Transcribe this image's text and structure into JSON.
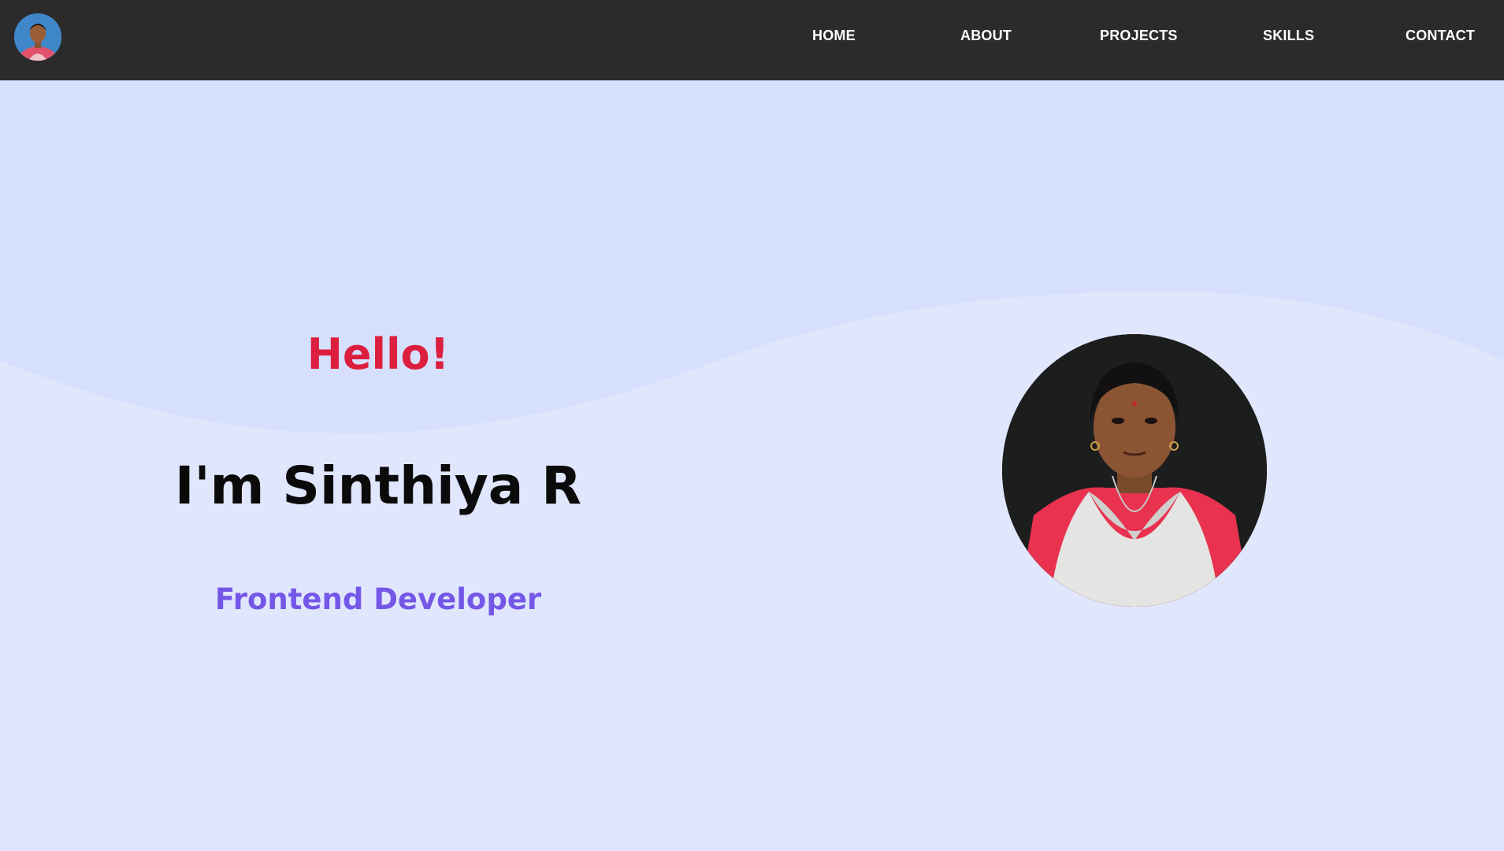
{
  "nav": {
    "logo_icon": "profile-avatar-icon",
    "links": [
      {
        "label": "HOME"
      },
      {
        "label": "ABOUT"
      },
      {
        "label": "PROJECTS"
      },
      {
        "label": "SKILLS"
      },
      {
        "label": "CONTACT"
      }
    ]
  },
  "hero": {
    "greeting": "Hello!",
    "name": "I'm Sinthiya R",
    "role": "Frontend Developer",
    "portrait_icon": "profile-photo"
  },
  "colors": {
    "navbar": "#2b2b2b",
    "background": "#e0e6fc",
    "wave": "#d6e0fd",
    "greeting": "#dc1f3f",
    "name": "#0b0b0b",
    "role": "#7557e8"
  }
}
